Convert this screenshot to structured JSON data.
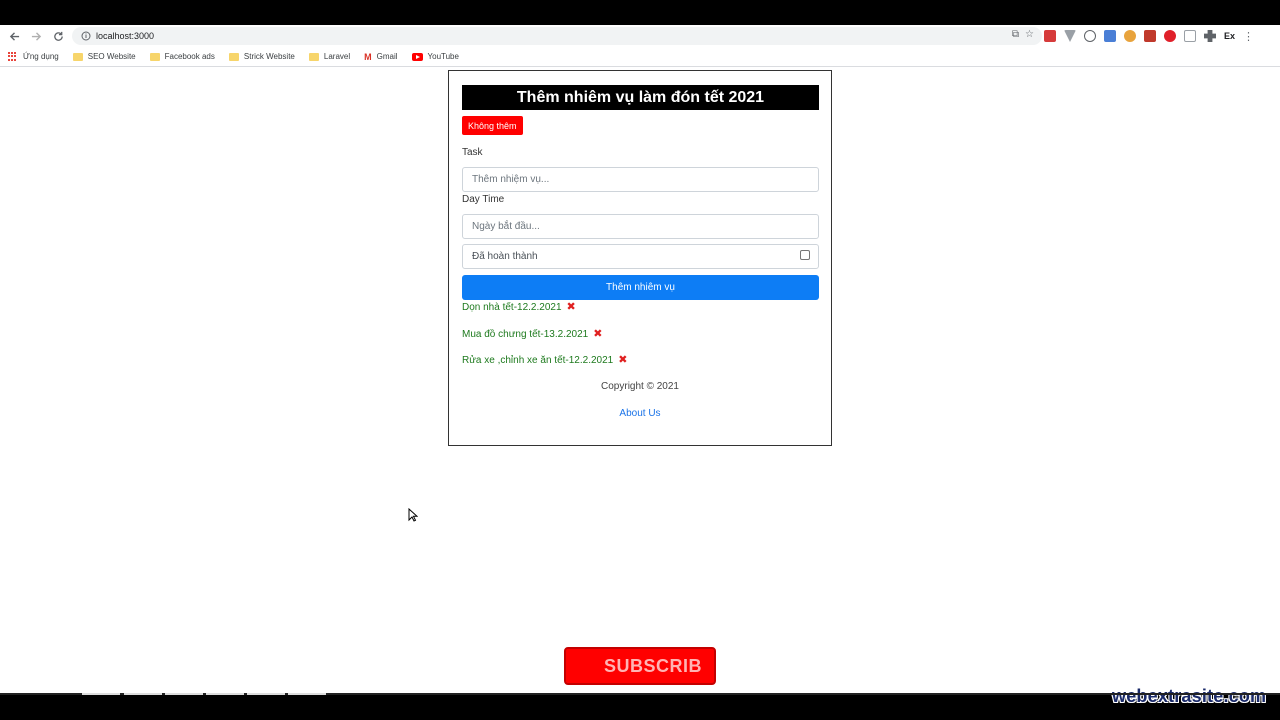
{
  "browser": {
    "url": "localhost:3000",
    "ext_label": "Ex",
    "bookmarks": [
      "Ứng dụng",
      "SEO Website",
      "Facebook ads",
      "Strick Website",
      "Laravel",
      "Gmail",
      "YouTube"
    ]
  },
  "app": {
    "title": "Thêm nhiêm vụ làm đón tết 2021",
    "cancel_button": "Không thêm",
    "task_label": "Task",
    "task_placeholder": "Thêm nhiệm vụ...",
    "daytime_label": "Day Time",
    "daytime_placeholder": "Ngày bắt đầu...",
    "completed_label": "Đã hoàn thành",
    "add_button": "Thêm nhiêm vụ",
    "tasks": [
      "Dọn nhà tết-12.2.2021",
      "Mua đồ chưng tết-13.2.2021",
      "Rửa xe ,chỉnh xe ăn tết-12.2.2021"
    ],
    "copyright": "Copyright © 2021",
    "about_link": "About Us"
  },
  "overlay": {
    "subscribe": "SUBSCRIB",
    "watermark": "webextrasite.com"
  }
}
